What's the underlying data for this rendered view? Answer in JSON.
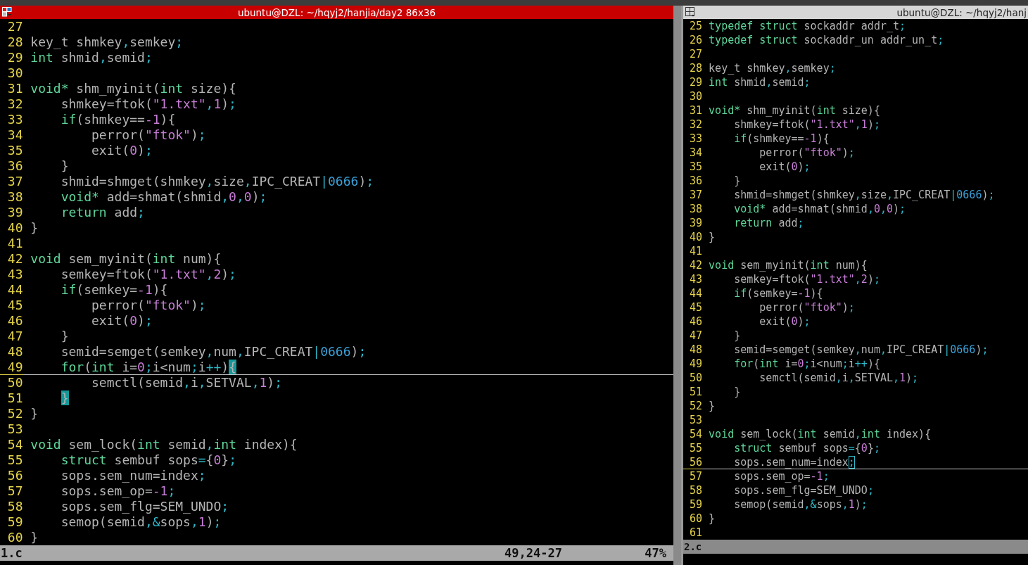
{
  "panes": [
    {
      "title": "ubuntu@DZL: ~/hqyj2/hanjia/day2 86x36",
      "active": true,
      "lines": [
        {
          "number": "27",
          "current": false
        },
        {
          "number": "28",
          "current": false,
          "tokens": [
            {
              "text": "key_t shmkey",
              "kind": "plain"
            },
            {
              "text": ",",
              "kind": "punct"
            },
            {
              "text": "semkey",
              "kind": "plain"
            },
            {
              "text": ";",
              "kind": "punct"
            }
          ]
        },
        {
          "number": "29",
          "current": false,
          "tokens": [
            {
              "text": "int",
              "kind": "kw"
            },
            {
              "text": " shmid",
              "kind": "plain"
            },
            {
              "text": ",",
              "kind": "punct"
            },
            {
              "text": "semid",
              "kind": "plain"
            },
            {
              "text": ";",
              "kind": "punct"
            }
          ]
        },
        {
          "number": "30",
          "current": false
        },
        {
          "number": "31",
          "current": false,
          "tokens": [
            {
              "text": "void*",
              "kind": "kw"
            },
            {
              "text": " shm_myinit(",
              "kind": "plain"
            },
            {
              "text": "int",
              "kind": "kw"
            },
            {
              "text": " size){",
              "kind": "plain"
            }
          ]
        },
        {
          "number": "32",
          "current": false,
          "tokens": [
            {
              "text": "    shmkey=ftok(",
              "kind": "plain"
            },
            {
              "text": "\"1.txt\"",
              "kind": "str"
            },
            {
              "text": ",",
              "kind": "punct"
            },
            {
              "text": "1",
              "kind": "num"
            },
            {
              "text": ")",
              "kind": "plain"
            },
            {
              "text": ";",
              "kind": "punct"
            }
          ]
        },
        {
          "number": "33",
          "current": false,
          "tokens": [
            {
              "text": "    if",
              "kind": "kw"
            },
            {
              "text": "(shmkey==",
              "kind": "plain"
            },
            {
              "text": "-1",
              "kind": "num"
            },
            {
              "text": "){",
              "kind": "plain"
            }
          ]
        },
        {
          "number": "34",
          "current": false,
          "tokens": [
            {
              "text": "        perror(",
              "kind": "plain"
            },
            {
              "text": "\"ftok\"",
              "kind": "str"
            },
            {
              "text": ")",
              "kind": "plain"
            },
            {
              "text": ";",
              "kind": "punct"
            }
          ]
        },
        {
          "number": "35",
          "current": false,
          "tokens": [
            {
              "text": "        exit(",
              "kind": "plain"
            },
            {
              "text": "0",
              "kind": "num"
            },
            {
              "text": ")",
              "kind": "plain"
            },
            {
              "text": ";",
              "kind": "punct"
            }
          ]
        },
        {
          "number": "36",
          "current": false,
          "tokens": [
            {
              "text": "    }",
              "kind": "plain"
            }
          ]
        },
        {
          "number": "37",
          "current": false,
          "tokens": [
            {
              "text": "    shmid=shmget(shmkey",
              "kind": "plain"
            },
            {
              "text": ",",
              "kind": "punct"
            },
            {
              "text": "size",
              "kind": "plain"
            },
            {
              "text": ",",
              "kind": "punct"
            },
            {
              "text": "IPC_CREAT",
              "kind": "plain"
            },
            {
              "text": "|",
              "kind": "punct"
            },
            {
              "text": "0666",
              "kind": "oct"
            },
            {
              "text": ")",
              "kind": "plain"
            },
            {
              "text": ";",
              "kind": "punct"
            }
          ]
        },
        {
          "number": "38",
          "current": false,
          "tokens": [
            {
              "text": "    void*",
              "kind": "kw"
            },
            {
              "text": " add=shmat(shmid",
              "kind": "plain"
            },
            {
              "text": ",",
              "kind": "punct"
            },
            {
              "text": "0",
              "kind": "num"
            },
            {
              "text": ",",
              "kind": "punct"
            },
            {
              "text": "0",
              "kind": "num"
            },
            {
              "text": ")",
              "kind": "plain"
            },
            {
              "text": ";",
              "kind": "punct"
            }
          ]
        },
        {
          "number": "39",
          "current": false,
          "tokens": [
            {
              "text": "    return",
              "kind": "kw"
            },
            {
              "text": " add",
              "kind": "plain"
            },
            {
              "text": ";",
              "kind": "punct"
            }
          ]
        },
        {
          "number": "40",
          "current": false,
          "tokens": [
            {
              "text": "}",
              "kind": "plain"
            }
          ]
        },
        {
          "number": "41",
          "current": false
        },
        {
          "number": "42",
          "current": false,
          "tokens": [
            {
              "text": "void",
              "kind": "kw"
            },
            {
              "text": " sem_myinit(",
              "kind": "plain"
            },
            {
              "text": "int",
              "kind": "kw"
            },
            {
              "text": " num){",
              "kind": "plain"
            }
          ]
        },
        {
          "number": "43",
          "current": false,
          "tokens": [
            {
              "text": "    semkey=ftok(",
              "kind": "plain"
            },
            {
              "text": "\"1.txt\"",
              "kind": "str"
            },
            {
              "text": ",",
              "kind": "punct"
            },
            {
              "text": "2",
              "kind": "num"
            },
            {
              "text": ")",
              "kind": "plain"
            },
            {
              "text": ";",
              "kind": "punct"
            }
          ]
        },
        {
          "number": "44",
          "current": false,
          "tokens": [
            {
              "text": "    if",
              "kind": "kw"
            },
            {
              "text": "(semkey=",
              "kind": "plain"
            },
            {
              "text": "-1",
              "kind": "num"
            },
            {
              "text": "){",
              "kind": "plain"
            }
          ]
        },
        {
          "number": "45",
          "current": false,
          "tokens": [
            {
              "text": "        perror(",
              "kind": "plain"
            },
            {
              "text": "\"ftok\"",
              "kind": "str"
            },
            {
              "text": ")",
              "kind": "plain"
            },
            {
              "text": ";",
              "kind": "punct"
            }
          ]
        },
        {
          "number": "46",
          "current": false,
          "tokens": [
            {
              "text": "        exit(",
              "kind": "plain"
            },
            {
              "text": "0",
              "kind": "num"
            },
            {
              "text": ")",
              "kind": "plain"
            },
            {
              "text": ";",
              "kind": "punct"
            }
          ]
        },
        {
          "number": "47",
          "current": false,
          "tokens": [
            {
              "text": "    }",
              "kind": "plain"
            }
          ]
        },
        {
          "number": "48",
          "current": false,
          "tokens": [
            {
              "text": "    semid=semget(semkey",
              "kind": "plain"
            },
            {
              "text": ",",
              "kind": "punct"
            },
            {
              "text": "num",
              "kind": "plain"
            },
            {
              "text": ",",
              "kind": "punct"
            },
            {
              "text": "IPC_CREAT",
              "kind": "plain"
            },
            {
              "text": "|",
              "kind": "punct"
            },
            {
              "text": "0666",
              "kind": "oct"
            },
            {
              "text": ")",
              "kind": "plain"
            },
            {
              "text": ";",
              "kind": "punct"
            }
          ]
        },
        {
          "number": "49",
          "current": true,
          "tokens": [
            {
              "text": "    for",
              "kind": "kw"
            },
            {
              "text": "(",
              "kind": "plain"
            },
            {
              "text": "int",
              "kind": "kw"
            },
            {
              "text": " i=",
              "kind": "plain"
            },
            {
              "text": "0",
              "kind": "num"
            },
            {
              "text": ";",
              "kind": "punct"
            },
            {
              "text": "i<num",
              "kind": "plain"
            },
            {
              "text": ";",
              "kind": "punct"
            },
            {
              "text": "i",
              "kind": "plain"
            },
            {
              "text": "++",
              "kind": "punct"
            },
            {
              "text": ")",
              "kind": "plain"
            },
            {
              "text": "{",
              "kind": "match"
            }
          ]
        },
        {
          "number": "50",
          "current": false,
          "tokens": [
            {
              "text": "        semctl(semid",
              "kind": "plain"
            },
            {
              "text": ",",
              "kind": "punct"
            },
            {
              "text": "i",
              "kind": "plain"
            },
            {
              "text": ",",
              "kind": "punct"
            },
            {
              "text": "SETVAL",
              "kind": "plain"
            },
            {
              "text": ",",
              "kind": "punct"
            },
            {
              "text": "1",
              "kind": "num"
            },
            {
              "text": ")",
              "kind": "plain"
            },
            {
              "text": ";",
              "kind": "punct"
            }
          ]
        },
        {
          "number": "51",
          "current": false,
          "tokens": [
            {
              "text": "    }",
              "kind": "match"
            }
          ]
        },
        {
          "number": "52",
          "current": false,
          "tokens": [
            {
              "text": "}",
              "kind": "plain"
            }
          ]
        },
        {
          "number": "53",
          "current": false
        },
        {
          "number": "54",
          "current": false,
          "tokens": [
            {
              "text": "void",
              "kind": "kw"
            },
            {
              "text": " sem_lock(",
              "kind": "plain"
            },
            {
              "text": "int",
              "kind": "kw"
            },
            {
              "text": " semid",
              "kind": "plain"
            },
            {
              "text": ",",
              "kind": "punct"
            },
            {
              "text": "int",
              "kind": "kw"
            },
            {
              "text": " index){",
              "kind": "plain"
            }
          ]
        },
        {
          "number": "55",
          "current": false,
          "tokens": [
            {
              "text": "    struct",
              "kind": "kw"
            },
            {
              "text": " sembuf sops",
              "kind": "plain"
            },
            {
              "text": "=",
              "kind": "punct"
            },
            {
              "text": "{",
              "kind": "plain"
            },
            {
              "text": "0",
              "kind": "num"
            },
            {
              "text": "}",
              "kind": "plain"
            },
            {
              "text": ";",
              "kind": "punct"
            }
          ]
        },
        {
          "number": "56",
          "current": false,
          "tokens": [
            {
              "text": "    sops.sem_num=index",
              "kind": "plain"
            },
            {
              "text": ";",
              "kind": "punct"
            }
          ]
        },
        {
          "number": "57",
          "current": false,
          "tokens": [
            {
              "text": "    sops.sem_op=",
              "kind": "plain"
            },
            {
              "text": "-1",
              "kind": "num"
            },
            {
              "text": ";",
              "kind": "punct"
            }
          ]
        },
        {
          "number": "58",
          "current": false,
          "tokens": [
            {
              "text": "    sops.sem_flg=SEM_UNDO",
              "kind": "plain"
            },
            {
              "text": ";",
              "kind": "punct"
            }
          ]
        },
        {
          "number": "59",
          "current": false,
          "tokens": [
            {
              "text": "    semop(semid",
              "kind": "plain"
            },
            {
              "text": ",",
              "kind": "punct"
            },
            {
              "text": "&",
              "kind": "punct"
            },
            {
              "text": "sops",
              "kind": "plain"
            },
            {
              "text": ",",
              "kind": "punct"
            },
            {
              "text": "1",
              "kind": "num"
            },
            {
              "text": ")",
              "kind": "plain"
            },
            {
              "text": ";",
              "kind": "punct"
            }
          ]
        },
        {
          "number": "60",
          "current": false,
          "tokens": [
            {
              "text": "}",
              "kind": "plain"
            }
          ]
        }
      ],
      "status": {
        "file": "1.c",
        "position": "49,24-27",
        "percent": "47%"
      }
    },
    {
      "title": "ubuntu@DZL: ~/hqyj2/hanj",
      "active": false,
      "lines": [
        {
          "number": "25",
          "current": false,
          "tokens": [
            {
              "text": "typedef struct",
              "kind": "kw"
            },
            {
              "text": " sockaddr addr_t",
              "kind": "plain"
            },
            {
              "text": ";",
              "kind": "punct"
            }
          ]
        },
        {
          "number": "26",
          "current": false,
          "tokens": [
            {
              "text": "typedef struct",
              "kind": "kw"
            },
            {
              "text": " sockaddr_un addr_un_t",
              "kind": "plain"
            },
            {
              "text": ";",
              "kind": "punct"
            }
          ]
        },
        {
          "number": "27",
          "current": false
        },
        {
          "number": "28",
          "current": false,
          "tokens": [
            {
              "text": "key_t shmkey",
              "kind": "plain"
            },
            {
              "text": ",",
              "kind": "punct"
            },
            {
              "text": "semkey",
              "kind": "plain"
            },
            {
              "text": ";",
              "kind": "punct"
            }
          ]
        },
        {
          "number": "29",
          "current": false,
          "tokens": [
            {
              "text": "int",
              "kind": "kw"
            },
            {
              "text": " shmid",
              "kind": "plain"
            },
            {
              "text": ",",
              "kind": "punct"
            },
            {
              "text": "semid",
              "kind": "plain"
            },
            {
              "text": ";",
              "kind": "punct"
            }
          ]
        },
        {
          "number": "30",
          "current": false
        },
        {
          "number": "31",
          "current": false,
          "tokens": [
            {
              "text": "void*",
              "kind": "kw"
            },
            {
              "text": " shm_myinit(",
              "kind": "plain"
            },
            {
              "text": "int",
              "kind": "kw"
            },
            {
              "text": " size){",
              "kind": "plain"
            }
          ]
        },
        {
          "number": "32",
          "current": false,
          "tokens": [
            {
              "text": "    shmkey=ftok(",
              "kind": "plain"
            },
            {
              "text": "\"1.txt\"",
              "kind": "str"
            },
            {
              "text": ",",
              "kind": "punct"
            },
            {
              "text": "1",
              "kind": "num"
            },
            {
              "text": ")",
              "kind": "plain"
            },
            {
              "text": ";",
              "kind": "punct"
            }
          ]
        },
        {
          "number": "33",
          "current": false,
          "tokens": [
            {
              "text": "    if",
              "kind": "kw"
            },
            {
              "text": "(shmkey==",
              "kind": "plain"
            },
            {
              "text": "-1",
              "kind": "num"
            },
            {
              "text": "){",
              "kind": "plain"
            }
          ]
        },
        {
          "number": "34",
          "current": false,
          "tokens": [
            {
              "text": "        perror(",
              "kind": "plain"
            },
            {
              "text": "\"ftok\"",
              "kind": "str"
            },
            {
              "text": ")",
              "kind": "plain"
            },
            {
              "text": ";",
              "kind": "punct"
            }
          ]
        },
        {
          "number": "35",
          "current": false,
          "tokens": [
            {
              "text": "        exit(",
              "kind": "plain"
            },
            {
              "text": "0",
              "kind": "num"
            },
            {
              "text": ")",
              "kind": "plain"
            },
            {
              "text": ";",
              "kind": "punct"
            }
          ]
        },
        {
          "number": "36",
          "current": false,
          "tokens": [
            {
              "text": "    }",
              "kind": "plain"
            }
          ]
        },
        {
          "number": "37",
          "current": false,
          "tokens": [
            {
              "text": "    shmid=shmget(shmkey",
              "kind": "plain"
            },
            {
              "text": ",",
              "kind": "punct"
            },
            {
              "text": "size",
              "kind": "plain"
            },
            {
              "text": ",",
              "kind": "punct"
            },
            {
              "text": "IPC_CREAT",
              "kind": "plain"
            },
            {
              "text": "|",
              "kind": "punct"
            },
            {
              "text": "0666",
              "kind": "oct"
            },
            {
              "text": ")",
              "kind": "plain"
            },
            {
              "text": ";",
              "kind": "punct"
            }
          ]
        },
        {
          "number": "38",
          "current": false,
          "tokens": [
            {
              "text": "    void*",
              "kind": "kw"
            },
            {
              "text": " add=shmat(shmid",
              "kind": "plain"
            },
            {
              "text": ",",
              "kind": "punct"
            },
            {
              "text": "0",
              "kind": "num"
            },
            {
              "text": ",",
              "kind": "punct"
            },
            {
              "text": "0",
              "kind": "num"
            },
            {
              "text": ")",
              "kind": "plain"
            },
            {
              "text": ";",
              "kind": "punct"
            }
          ]
        },
        {
          "number": "39",
          "current": false,
          "tokens": [
            {
              "text": "    return",
              "kind": "kw"
            },
            {
              "text": " add",
              "kind": "plain"
            },
            {
              "text": ";",
              "kind": "punct"
            }
          ]
        },
        {
          "number": "40",
          "current": false,
          "tokens": [
            {
              "text": "}",
              "kind": "plain"
            }
          ]
        },
        {
          "number": "41",
          "current": false
        },
        {
          "number": "42",
          "current": false,
          "tokens": [
            {
              "text": "void",
              "kind": "kw"
            },
            {
              "text": " sem_myinit(",
              "kind": "plain"
            },
            {
              "text": "int",
              "kind": "kw"
            },
            {
              "text": " num){",
              "kind": "plain"
            }
          ]
        },
        {
          "number": "43",
          "current": false,
          "tokens": [
            {
              "text": "    semkey=ftok(",
              "kind": "plain"
            },
            {
              "text": "\"1.txt\"",
              "kind": "str"
            },
            {
              "text": ",",
              "kind": "punct"
            },
            {
              "text": "2",
              "kind": "num"
            },
            {
              "text": ")",
              "kind": "plain"
            },
            {
              "text": ";",
              "kind": "punct"
            }
          ]
        },
        {
          "number": "44",
          "current": false,
          "tokens": [
            {
              "text": "    if",
              "kind": "kw"
            },
            {
              "text": "(semkey=",
              "kind": "plain"
            },
            {
              "text": "-1",
              "kind": "num"
            },
            {
              "text": "){",
              "kind": "plain"
            }
          ]
        },
        {
          "number": "45",
          "current": false,
          "tokens": [
            {
              "text": "        perror(",
              "kind": "plain"
            },
            {
              "text": "\"ftok\"",
              "kind": "str"
            },
            {
              "text": ")",
              "kind": "plain"
            },
            {
              "text": ";",
              "kind": "punct"
            }
          ]
        },
        {
          "number": "46",
          "current": false,
          "tokens": [
            {
              "text": "        exit(",
              "kind": "plain"
            },
            {
              "text": "0",
              "kind": "num"
            },
            {
              "text": ")",
              "kind": "plain"
            },
            {
              "text": ";",
              "kind": "punct"
            }
          ]
        },
        {
          "number": "47",
          "current": false,
          "tokens": [
            {
              "text": "    }",
              "kind": "plain"
            }
          ]
        },
        {
          "number": "48",
          "current": false,
          "tokens": [
            {
              "text": "    semid=semget(semkey",
              "kind": "plain"
            },
            {
              "text": ",",
              "kind": "punct"
            },
            {
              "text": "num",
              "kind": "plain"
            },
            {
              "text": ",",
              "kind": "punct"
            },
            {
              "text": "IPC_CREAT",
              "kind": "plain"
            },
            {
              "text": "|",
              "kind": "punct"
            },
            {
              "text": "0666",
              "kind": "oct"
            },
            {
              "text": ")",
              "kind": "plain"
            },
            {
              "text": ";",
              "kind": "punct"
            }
          ]
        },
        {
          "number": "49",
          "current": false,
          "tokens": [
            {
              "text": "    for",
              "kind": "kw"
            },
            {
              "text": "(",
              "kind": "plain"
            },
            {
              "text": "int",
              "kind": "kw"
            },
            {
              "text": " i=",
              "kind": "plain"
            },
            {
              "text": "0",
              "kind": "num"
            },
            {
              "text": ";",
              "kind": "punct"
            },
            {
              "text": "i<num",
              "kind": "plain"
            },
            {
              "text": ";",
              "kind": "punct"
            },
            {
              "text": "i",
              "kind": "plain"
            },
            {
              "text": "++",
              "kind": "punct"
            },
            {
              "text": "){",
              "kind": "plain"
            }
          ]
        },
        {
          "number": "50",
          "current": false,
          "tokens": [
            {
              "text": "        semctl(semid",
              "kind": "plain"
            },
            {
              "text": ",",
              "kind": "punct"
            },
            {
              "text": "i",
              "kind": "plain"
            },
            {
              "text": ",",
              "kind": "punct"
            },
            {
              "text": "SETVAL",
              "kind": "plain"
            },
            {
              "text": ",",
              "kind": "punct"
            },
            {
              "text": "1",
              "kind": "num"
            },
            {
              "text": ")",
              "kind": "plain"
            },
            {
              "text": ";",
              "kind": "punct"
            }
          ]
        },
        {
          "number": "51",
          "current": false,
          "tokens": [
            {
              "text": "    }",
              "kind": "plain"
            }
          ]
        },
        {
          "number": "52",
          "current": false,
          "tokens": [
            {
              "text": "}",
              "kind": "plain"
            }
          ]
        },
        {
          "number": "53",
          "current": false
        },
        {
          "number": "54",
          "current": false,
          "tokens": [
            {
              "text": "void",
              "kind": "kw"
            },
            {
              "text": " sem_lock(",
              "kind": "plain"
            },
            {
              "text": "int",
              "kind": "kw"
            },
            {
              "text": " semid",
              "kind": "plain"
            },
            {
              "text": ",",
              "kind": "punct"
            },
            {
              "text": "int",
              "kind": "kw"
            },
            {
              "text": " index){",
              "kind": "plain"
            }
          ]
        },
        {
          "number": "55",
          "current": false,
          "tokens": [
            {
              "text": "    struct",
              "kind": "kw"
            },
            {
              "text": " sembuf sops",
              "kind": "plain"
            },
            {
              "text": "=",
              "kind": "punct"
            },
            {
              "text": "{",
              "kind": "plain"
            },
            {
              "text": "0",
              "kind": "num"
            },
            {
              "text": "}",
              "kind": "plain"
            },
            {
              "text": ";",
              "kind": "punct"
            }
          ]
        },
        {
          "number": "56",
          "current": true,
          "tokens": [
            {
              "text": "    sops.sem_num=index",
              "kind": "plain"
            },
            {
              "text": ";",
              "kind": "cursor"
            }
          ]
        },
        {
          "number": "57",
          "current": false,
          "tokens": [
            {
              "text": "    sops.sem_op=",
              "kind": "plain"
            },
            {
              "text": "-1",
              "kind": "num"
            },
            {
              "text": ";",
              "kind": "punct"
            }
          ]
        },
        {
          "number": "58",
          "current": false,
          "tokens": [
            {
              "text": "    sops.sem_flg=SEM_UNDO",
              "kind": "plain"
            },
            {
              "text": ";",
              "kind": "punct"
            }
          ]
        },
        {
          "number": "59",
          "current": false,
          "tokens": [
            {
              "text": "    semop(semid",
              "kind": "plain"
            },
            {
              "text": ",",
              "kind": "punct"
            },
            {
              "text": "&",
              "kind": "punct"
            },
            {
              "text": "sops",
              "kind": "plain"
            },
            {
              "text": ",",
              "kind": "punct"
            },
            {
              "text": "1",
              "kind": "num"
            },
            {
              "text": ")",
              "kind": "plain"
            },
            {
              "text": ";",
              "kind": "punct"
            }
          ]
        },
        {
          "number": "60",
          "current": false,
          "tokens": [
            {
              "text": "}",
              "kind": "plain"
            }
          ]
        },
        {
          "number": "61",
          "current": false
        }
      ],
      "status": {
        "file": "2.c"
      }
    }
  ]
}
